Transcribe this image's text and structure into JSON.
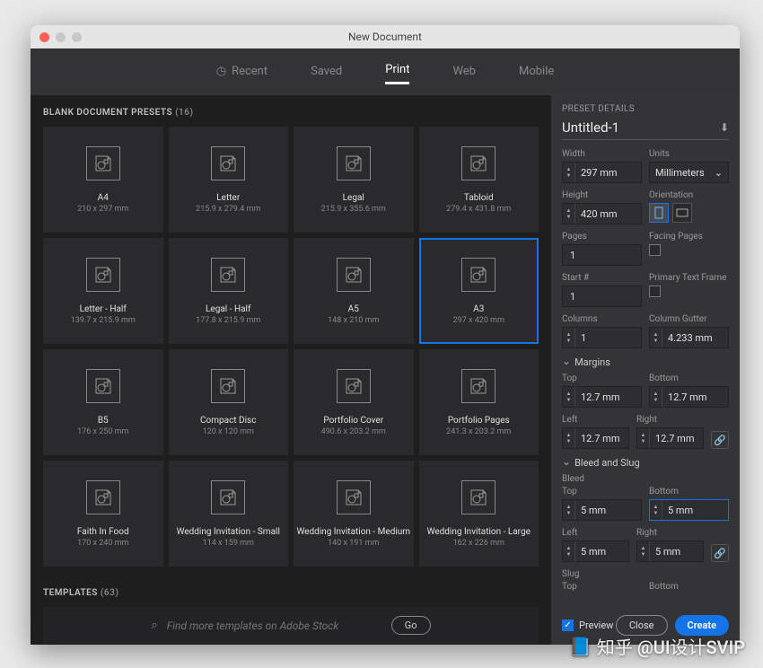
{
  "window": {
    "title": "New Document"
  },
  "tabs": {
    "recent": "Recent",
    "saved": "Saved",
    "print": "Print",
    "web": "Web",
    "mobile": "Mobile"
  },
  "sections": {
    "presets_label": "BLANK DOCUMENT PRESETS",
    "presets_count": "(16)",
    "templates_label": "TEMPLATES",
    "templates_count": "(63)"
  },
  "presets": [
    {
      "name": "A4",
      "dim": "210 x 297 mm"
    },
    {
      "name": "Letter",
      "dim": "215.9 x 279.4 mm"
    },
    {
      "name": "Legal",
      "dim": "215.9 x 355.6 mm"
    },
    {
      "name": "Tabloid",
      "dim": "279.4 x 431.8 mm"
    },
    {
      "name": "Letter - Half",
      "dim": "139.7 x 215.9 mm"
    },
    {
      "name": "Legal - Half",
      "dim": "177.8 x 215.9 mm"
    },
    {
      "name": "A5",
      "dim": "148 x 210 mm"
    },
    {
      "name": "A3",
      "dim": "297 x 420 mm",
      "selected": true
    },
    {
      "name": "B5",
      "dim": "176 x 250 mm"
    },
    {
      "name": "Compact Disc",
      "dim": "120 x 120 mm"
    },
    {
      "name": "Portfolio Cover",
      "dim": "490.6 x 203.2 mm"
    },
    {
      "name": "Portfolio Pages",
      "dim": "241.3 x 203.2 mm"
    },
    {
      "name": "Faith In Food",
      "dim": "170 x 240 mm"
    },
    {
      "name": "Wedding Invitation - Small",
      "dim": "114 x 159 mm"
    },
    {
      "name": "Wedding Invitation - Medium",
      "dim": "140 x 191 mm"
    },
    {
      "name": "Wedding Invitation - Large",
      "dim": "162 x 226 mm"
    }
  ],
  "search": {
    "placeholder": "Find more templates on Adobe Stock",
    "go": "Go"
  },
  "details": {
    "header": "PRESET DETAILS",
    "name": "Untitled-1",
    "width_lbl": "Width",
    "width": "297 mm",
    "units_lbl": "Units",
    "units": "Millimeters",
    "height_lbl": "Height",
    "height": "420 mm",
    "orient_lbl": "Orientation",
    "pages_lbl": "Pages",
    "pages": "1",
    "facing_lbl": "Facing Pages",
    "start_lbl": "Start #",
    "start": "1",
    "ptf_lbl": "Primary Text Frame",
    "cols_lbl": "Columns",
    "cols": "1",
    "gutter_lbl": "Column Gutter",
    "gutter": "4.233 mm",
    "margins_hdr": "Margins",
    "top_lbl": "Top",
    "bottom_lbl": "Bottom",
    "left_lbl": "Left",
    "right_lbl": "Right",
    "m_top": "12.7 mm",
    "m_bottom": "12.7 mm",
    "m_left": "12.7 mm",
    "m_right": "12.7 mm",
    "bleed_hdr": "Bleed and Slug",
    "bleed_lbl": "Bleed",
    "b_top": "5 mm",
    "b_bottom": "5 mm",
    "b_left": "5 mm",
    "b_right": "5 mm",
    "slug_lbl": "Slug"
  },
  "footer": {
    "preview": "Preview",
    "close": "Close",
    "create": "Create"
  },
  "watermark": "知乎 @UI设计SVIP"
}
